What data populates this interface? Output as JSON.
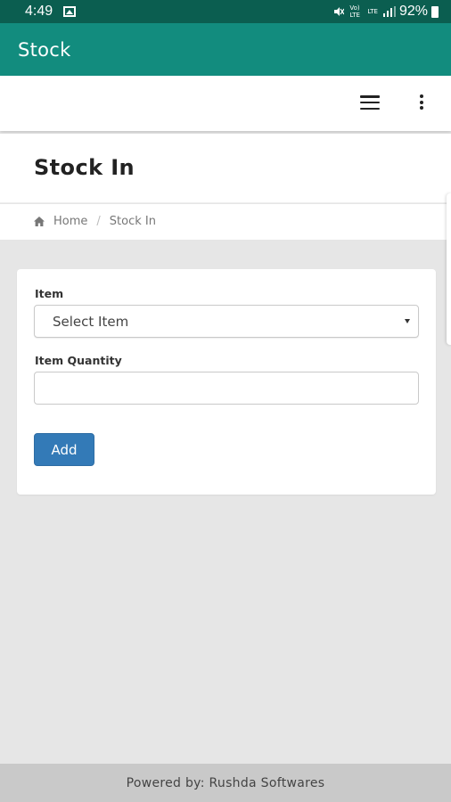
{
  "status_bar": {
    "time": "4:49",
    "network_vol_lte1": "Vo) LTE",
    "network_lte2": "LTE",
    "battery": "92%",
    "icons": [
      "image-icon",
      "mute-icon",
      "signal-icon",
      "battery-icon"
    ]
  },
  "app_bar": {
    "title": "Stock"
  },
  "nav": {
    "icons": [
      "hamburger-menu-icon",
      "overflow-menu-icon"
    ]
  },
  "page": {
    "title": "Stock In"
  },
  "breadcrumb": {
    "home": "Home",
    "separator": "/",
    "current": "Stock In"
  },
  "form": {
    "item_label": "Item",
    "item_select_value": "Select Item",
    "quantity_label": "Item Quantity",
    "quantity_value": "",
    "add_button": "Add"
  },
  "footer": {
    "text": "Powered by: Rushda Softwares"
  },
  "colors": {
    "status_bar": "#0b5e50",
    "app_bar": "#128c7e",
    "primary_button": "#337ab7",
    "background": "#e6e6e6",
    "footer": "#c9c9c9"
  }
}
